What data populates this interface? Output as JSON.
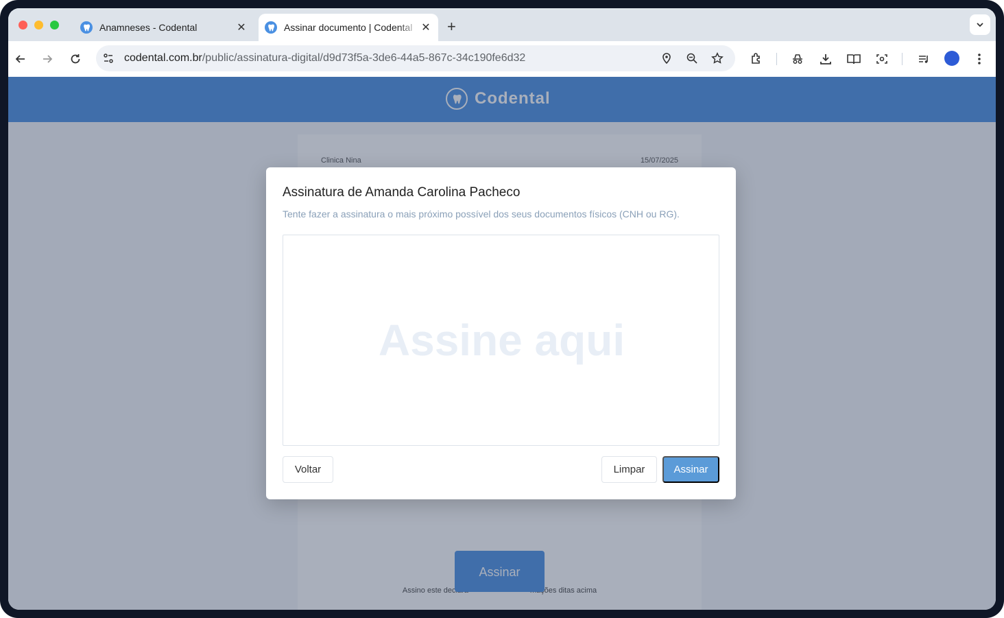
{
  "browser": {
    "tabs": [
      {
        "title": "Anamneses - Codental",
        "active": false
      },
      {
        "title": "Assinar documento | Codental",
        "active": true
      }
    ],
    "new_tab_label": "+",
    "close_label": "✕",
    "url_host": "codental.com.br",
    "url_path": "/public/assinatura-digital/d9d73f5a-3de6-44a5-867c-34c190fe6d32"
  },
  "page": {
    "brand": "Codental",
    "document": {
      "clinic": "Clinica Nina",
      "date": "15/07/2025",
      "sign_button": "Assinar",
      "declaration_start": "Assino este declara",
      "declaration_end": "mações ditas acima"
    }
  },
  "modal": {
    "title": "Assinatura de Amanda Carolina Pacheco",
    "subtitle": "Tente fazer a assinatura o mais próximo possível dos seus documentos físicos (CNH ou RG).",
    "placeholder": "Assine aqui",
    "back_button": "Voltar",
    "clear_button": "Limpar",
    "sign_button": "Assinar"
  },
  "colors": {
    "brand": "#4a90e2",
    "primary_button": "#5b9bd8",
    "overlay": "#32405c"
  }
}
